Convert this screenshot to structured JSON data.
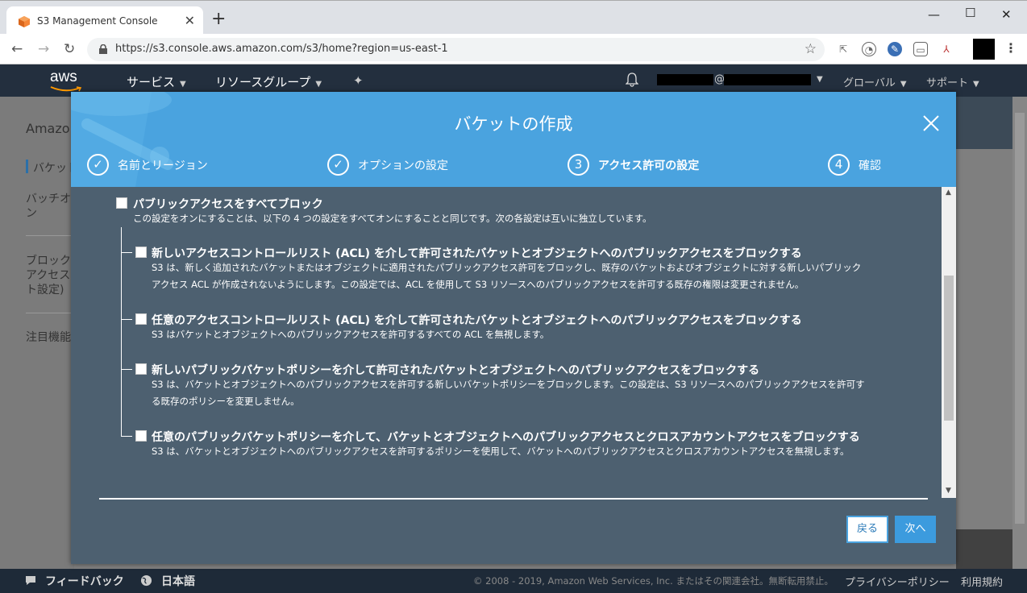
{
  "browser": {
    "tab_title": "S3 Management Console",
    "url": "https://s3.console.aws.amazon.com/s3/home?region=us-east-1"
  },
  "awsnav": {
    "logo": "aws",
    "services": "サービス",
    "resource_groups": "リソースグループ",
    "account_at": "@",
    "region": "グローバル",
    "support": "サポート"
  },
  "background": {
    "sidebar_title": "Amazo",
    "item1": "バケット",
    "item2a": "バッチオ",
    "item2b": "ン",
    "item3a": "ブロック",
    "item3b": "アクセス",
    "item3c": "ト設定)",
    "item4": "注目機能"
  },
  "modal": {
    "title": "バケットの作成",
    "steps": [
      {
        "marker": "✓",
        "label": "名前とリージョン"
      },
      {
        "marker": "✓",
        "label": "オプションの設定"
      },
      {
        "marker": "3",
        "label": "アクセス許可の設定"
      },
      {
        "marker": "4",
        "label": "確認"
      }
    ],
    "block_all": {
      "title": "パブリックアクセスをすべてブロック",
      "desc": "この設定をオンにすることは、以下の 4 つの設定をすべてオンにすることと同じです。次の各設定は互いに独立しています。"
    },
    "options": [
      {
        "title": "新しいアクセスコントロールリスト (ACL) を介して許可されたバケットとオブジェクトへのパブリックアクセスをブロックする",
        "desc1": "S3 は、新しく追加されたバケットまたはオブジェクトに適用されたパブリックアクセス許可をブロックし、既存のバケットおよびオブジェクトに対する新しいパブリック",
        "desc2": "アクセス ACL が作成されないようにします。この設定では、ACL を使用して S3 リソースへのパブリックアクセスを許可する既存の権限は変更されません。"
      },
      {
        "title": "任意のアクセスコントロールリスト (ACL) を介して許可されたバケットとオブジェクトへのパブリックアクセスをブロックする",
        "desc1": "S3 はバケットとオブジェクトへのパブリックアクセスを許可するすべての ACL を無視します。",
        "desc2": ""
      },
      {
        "title": "新しいパブリックバケットポリシーを介して許可されたバケットとオブジェクトへのパブリックアクセスをブロックする",
        "desc1": "S3 は、バケットとオブジェクトへのパブリックアクセスを許可する新しいバケットポリシーをブロックします。この設定は、S3 リソースへのパブリックアクセスを許可す",
        "desc2": "る既存のポリシーを変更しません。"
      },
      {
        "title": "任意のパブリックバケットポリシーを介して、バケットとオブジェクトへのパブリックアクセスとクロスアカウントアクセスをブロックする",
        "desc1": "S3 は、バケットとオブジェクトへのパブリックアクセスを許可するポリシーを使用して、バケットへのパブリックアクセスとクロスアカウントアクセスを無視します。",
        "desc2": ""
      }
    ],
    "back_label": "戻る",
    "next_label": "次へ"
  },
  "footer": {
    "feedback": "フィードバック",
    "language": "日本語",
    "copyright": "© 2008 - 2019, Amazon Web Services, Inc. またはその関連会社。無断転用禁止。",
    "privacy": "プライバシーポリシー",
    "terms": "利用規約"
  },
  "colors": {
    "modal_header": "#4aa3df",
    "modal_body": "#4d6070",
    "aws_nav": "#232f3e",
    "next_button": "#3c9bde"
  }
}
